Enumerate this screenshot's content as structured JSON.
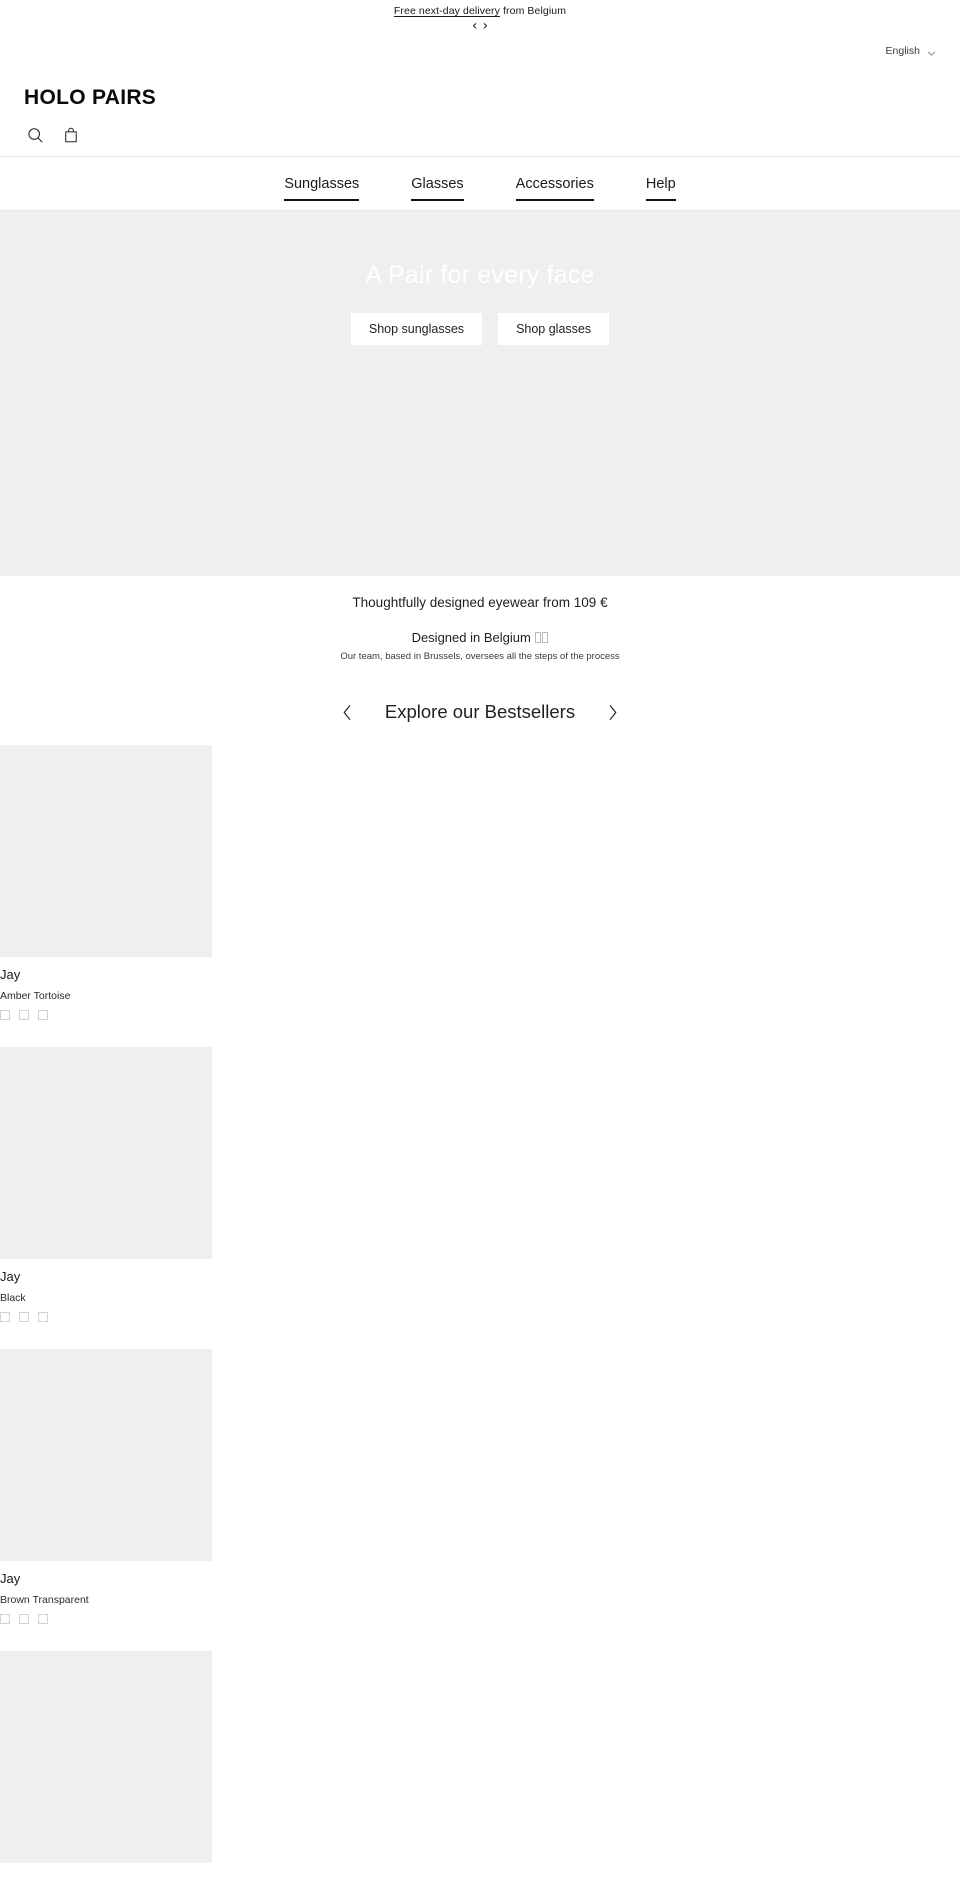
{
  "announcement": {
    "link_text": "Free next-day delivery",
    "rest_text": " from Belgium",
    "prev_icon": "chevron-left-icon",
    "next_icon": "chevron-right-icon",
    "prev_label": "‹",
    "next_label": "›"
  },
  "language": {
    "selected": "English",
    "chevron_icon": "chevron-down-icon"
  },
  "header": {
    "logo": "HOLO PAIRS",
    "search_icon": "search-icon",
    "cart_icon": "shopping-bag-icon"
  },
  "nav": {
    "items": [
      {
        "label": "Sunglasses"
      },
      {
        "label": "Glasses"
      },
      {
        "label": "Accessories"
      },
      {
        "label": "Help"
      }
    ]
  },
  "hero": {
    "headline": "A Pair for every face",
    "background_color": "#efefef",
    "headline_color": "#ffffff",
    "buttons": [
      {
        "label": "Shop sunglasses"
      },
      {
        "label": "Shop glasses"
      }
    ]
  },
  "value_section": {
    "headline": "Thoughtfully designed eyewear from 109 €",
    "title": "Designed in Belgium",
    "flag": "🇧🇪",
    "subtitle": "Our team, based in Brussels, oversees all the steps of the process"
  },
  "bestsellers": {
    "title": "Explore our Bestsellers",
    "prev_icon": "chevron-left-icon",
    "next_icon": "chevron-right-icon",
    "prev_label": "‹",
    "next_label": "›",
    "products": [
      {
        "name": "Jay",
        "variant": "Amber Tortoise",
        "swatch_count": 3
      },
      {
        "name": "Jay",
        "variant": "Black",
        "swatch_count": 3
      },
      {
        "name": "Jay",
        "variant": "Brown Transparent",
        "swatch_count": 3
      },
      {
        "name": "",
        "variant": "",
        "swatch_count": 0
      }
    ]
  }
}
